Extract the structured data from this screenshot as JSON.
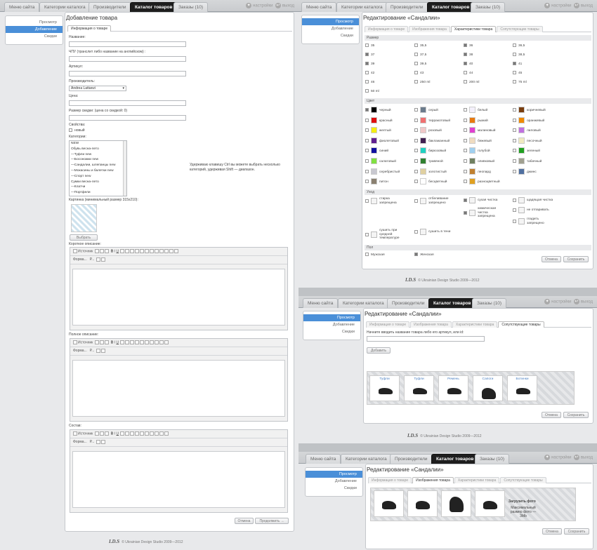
{
  "nav": [
    "Меню сайта",
    "Категории каталога",
    "Производители",
    "Каталог товаров",
    "Заказы (10)"
  ],
  "top_right": {
    "settings": "настройки",
    "logout": "выход"
  },
  "sidebar": [
    "Просмотр",
    "Добавление",
    "Скидки"
  ],
  "footer": {
    "logo": "I.D.S",
    "copyright": "© Ukrainian Design Studio 2009—2012"
  },
  "add_form": {
    "title": "Добавление товара",
    "subtab": "Информация о товаре",
    "name_label": "Название:",
    "slug_label": "ЧПУ (транслит либо название на английском) :",
    "sku_label": "Артикул:",
    "maker_label": "Производитель:",
    "maker_value": "Andrea Lattanzi",
    "price_label": "Цена:",
    "discount_label": "Размер скидки: (цена со скидкой: 0)",
    "props_label": "Свойства:",
    "props_new": "новый",
    "cats_label": "Категории:",
    "categories": [
      "NEW",
      "Обувь весна-лето",
      "—Туфли new",
      "—Босоножки new",
      "—Сандалии, шлепанцы new",
      "—Мокасины и балетки new",
      "—Спорт new",
      "Сумки весна-лето",
      "—Клатчи",
      "—Портфели"
    ],
    "ctrl_hint": "Удерживаю клавишу Ctrl вы можете выбрать несколько категорий, удерживая Shift — диапазон.",
    "image_label": "Картинка (минимальный размер 315x210):",
    "choose_btn": "Выбрать",
    "short_desc_label": "Короткое описание:",
    "full_desc_label": "Полное описание:",
    "composition_label": "Состав:",
    "editor_source": "Источник",
    "editor_format": "Форма...",
    "editor_size": "Р...",
    "cancel": "Отмена",
    "continue": "Продолжить →"
  },
  "edit_title": "Редактирование «Сандалии»",
  "edit_tabs": [
    "Информация о товаре",
    "Изображения товара",
    "Характеристики товара",
    "Сопутствующие товары"
  ],
  "chars": {
    "size_header": "Размер",
    "sizes": [
      [
        "35",
        false
      ],
      [
        "35,5",
        false
      ],
      [
        "36",
        true
      ],
      [
        "36,5",
        false
      ],
      [
        "37",
        true
      ],
      [
        "37,5",
        false
      ],
      [
        "38",
        true
      ],
      [
        "38,5",
        false
      ],
      [
        "39",
        true
      ],
      [
        "39,5",
        false
      ],
      [
        "40",
        true
      ],
      [
        "41",
        true
      ],
      [
        "42",
        false
      ],
      [
        "43",
        false
      ],
      [
        "44",
        false
      ],
      [
        "45",
        false
      ],
      [
        "46",
        false
      ],
      [
        "250 ml",
        false
      ],
      [
        "200 ml",
        false
      ],
      [
        "75 ml",
        false
      ],
      [
        "50 ml",
        false
      ]
    ],
    "color_header": "Цвет",
    "colors": [
      [
        "черный",
        "#000000",
        true
      ],
      [
        "серый",
        "#6b7b8c",
        false
      ],
      [
        "белый",
        "#f4f0fb",
        false
      ],
      [
        "коричневый",
        "#7a3f10",
        false
      ],
      [
        "красный",
        "#e01010",
        false
      ],
      [
        "терракотовый",
        "#f07070",
        false
      ],
      [
        "рыжий",
        "#e87a10",
        false
      ],
      [
        "оранжевый",
        "#f08a00",
        false
      ],
      [
        "желтый",
        "#f4ee10",
        false
      ],
      [
        "розовый",
        "#f0c8c8",
        false
      ],
      [
        "малиновый",
        "#e040d0",
        false
      ],
      [
        "лиловый",
        "#c070e0",
        false
      ],
      [
        "фиолетовый",
        "#602090",
        false
      ],
      [
        "баклажанный",
        "#402050",
        false
      ],
      [
        "бежевый",
        "#f0dcc0",
        false
      ],
      [
        "песочный",
        "#f0eac0",
        false
      ],
      [
        "синий",
        "#1010a0",
        false
      ],
      [
        "бирюзовый",
        "#20d0c0",
        false
      ],
      [
        "голубой",
        "#a0d0f0",
        false
      ],
      [
        "зеленый",
        "#20a020",
        false
      ],
      [
        "салатовый",
        "#80e040",
        false
      ],
      [
        "травяной",
        "#308030",
        false
      ],
      [
        "оливковый",
        "#708060",
        false
      ],
      [
        "табачный",
        "#a0a090",
        false
      ],
      [
        "серебристый",
        "#c8c8d0",
        false
      ],
      [
        "золотистый",
        "#e0d0a0",
        false
      ],
      [
        "леопард",
        "#c08030",
        false
      ],
      [
        "джинс",
        "#5070a0",
        false
      ],
      [
        "питон",
        "#8a8070",
        false
      ],
      [
        "бесцветный",
        "#ffffff",
        false
      ],
      [
        "разноцветный",
        "#e0a020",
        false
      ]
    ],
    "care_header": "Уход",
    "care": [
      [
        "стирка запрещена",
        false
      ],
      [
        "отбеливание запрещено",
        false
      ],
      [
        "сухая чистка",
        true
      ],
      [
        "щадящая чистка",
        false
      ],
      [
        "химическая чистка запрещена",
        true
      ],
      [
        "не отпаривать",
        false
      ],
      [
        "сушить при средней температуре",
        false
      ],
      [
        "сушить в тени",
        false
      ],
      [
        "гладить запрещено",
        false
      ]
    ],
    "gender_header": "Пол",
    "genders": [
      [
        "Мужская",
        false
      ],
      [
        "Женская",
        true
      ]
    ],
    "cancel": "Отмена",
    "save": "Сохранить"
  },
  "related": {
    "search_label": "Начните вводить название товара либо его артикул, или id:",
    "add_btn": "Добавить",
    "items": [
      "Туфли",
      "Туфли",
      "Ремень",
      "Сапоги",
      "Ботинки"
    ],
    "cancel": "Отмена",
    "save": "Сохранить"
  },
  "images": {
    "upload": "Загрузить фото",
    "max_size": "Максимальный размер фото — 3Mb",
    "cancel": "Отмена",
    "save": "Сохранить"
  }
}
